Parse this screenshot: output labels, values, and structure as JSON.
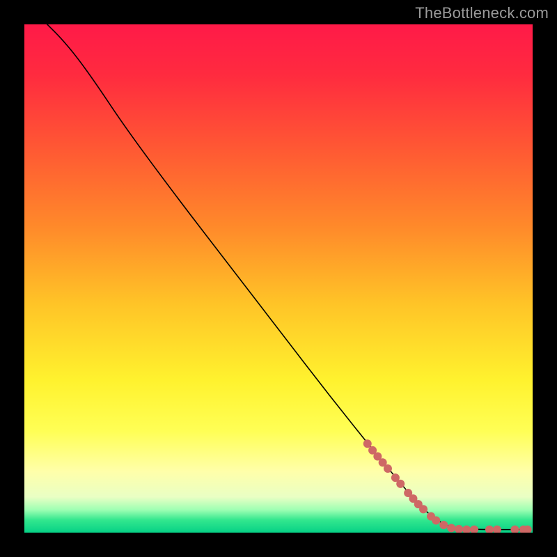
{
  "watermark": "TheBottleneck.com",
  "chart_data": {
    "type": "line",
    "title": "",
    "xlabel": "",
    "ylabel": "",
    "xlim": [
      0,
      100
    ],
    "ylim": [
      0,
      100
    ],
    "grid": false,
    "legend": null,
    "background_gradient": {
      "stops": [
        {
          "offset": 0.0,
          "color": "#ff1a48"
        },
        {
          "offset": 0.1,
          "color": "#ff2b3f"
        },
        {
          "offset": 0.25,
          "color": "#ff5a33"
        },
        {
          "offset": 0.4,
          "color": "#ff8a2a"
        },
        {
          "offset": 0.55,
          "color": "#ffc427"
        },
        {
          "offset": 0.7,
          "color": "#fff22e"
        },
        {
          "offset": 0.8,
          "color": "#ffff55"
        },
        {
          "offset": 0.88,
          "color": "#ffffaa"
        },
        {
          "offset": 0.93,
          "color": "#e9ffc4"
        },
        {
          "offset": 0.955,
          "color": "#9effb3"
        },
        {
          "offset": 0.975,
          "color": "#33e78e"
        },
        {
          "offset": 1.0,
          "color": "#06d186"
        }
      ]
    },
    "curve": {
      "stroke": "#000000",
      "stroke_width": 1.6,
      "points": [
        {
          "x": 4.0,
          "y": 100.5
        },
        {
          "x": 5.0,
          "y": 99.5
        },
        {
          "x": 7.0,
          "y": 97.5
        },
        {
          "x": 10.0,
          "y": 94.0
        },
        {
          "x": 14.0,
          "y": 88.5
        },
        {
          "x": 20.0,
          "y": 79.5
        },
        {
          "x": 30.0,
          "y": 66.0
        },
        {
          "x": 40.0,
          "y": 53.0
        },
        {
          "x": 50.0,
          "y": 40.0
        },
        {
          "x": 60.0,
          "y": 27.0
        },
        {
          "x": 70.0,
          "y": 14.5
        },
        {
          "x": 78.0,
          "y": 5.0
        },
        {
          "x": 82.0,
          "y": 1.8
        },
        {
          "x": 85.0,
          "y": 0.8
        },
        {
          "x": 90.0,
          "y": 0.6
        },
        {
          "x": 95.0,
          "y": 0.6
        },
        {
          "x": 99.5,
          "y": 0.6
        }
      ]
    },
    "markers": {
      "color": "#ce6865",
      "radius": 6,
      "points": [
        {
          "x": 67.5,
          "y": 17.5
        },
        {
          "x": 68.5,
          "y": 16.2
        },
        {
          "x": 69.5,
          "y": 15.0
        },
        {
          "x": 70.5,
          "y": 13.8
        },
        {
          "x": 71.5,
          "y": 12.6
        },
        {
          "x": 73.0,
          "y": 10.8
        },
        {
          "x": 74.0,
          "y": 9.6
        },
        {
          "x": 75.5,
          "y": 7.8
        },
        {
          "x": 76.5,
          "y": 6.7
        },
        {
          "x": 77.5,
          "y": 5.6
        },
        {
          "x": 78.5,
          "y": 4.6
        },
        {
          "x": 80.0,
          "y": 3.2
        },
        {
          "x": 81.0,
          "y": 2.4
        },
        {
          "x": 82.5,
          "y": 1.5
        },
        {
          "x": 84.0,
          "y": 0.9
        },
        {
          "x": 85.5,
          "y": 0.7
        },
        {
          "x": 87.0,
          "y": 0.6
        },
        {
          "x": 88.5,
          "y": 0.6
        },
        {
          "x": 91.5,
          "y": 0.6
        },
        {
          "x": 93.0,
          "y": 0.6
        },
        {
          "x": 96.5,
          "y": 0.6
        },
        {
          "x": 98.2,
          "y": 0.6
        },
        {
          "x": 99.0,
          "y": 0.6
        }
      ]
    }
  }
}
